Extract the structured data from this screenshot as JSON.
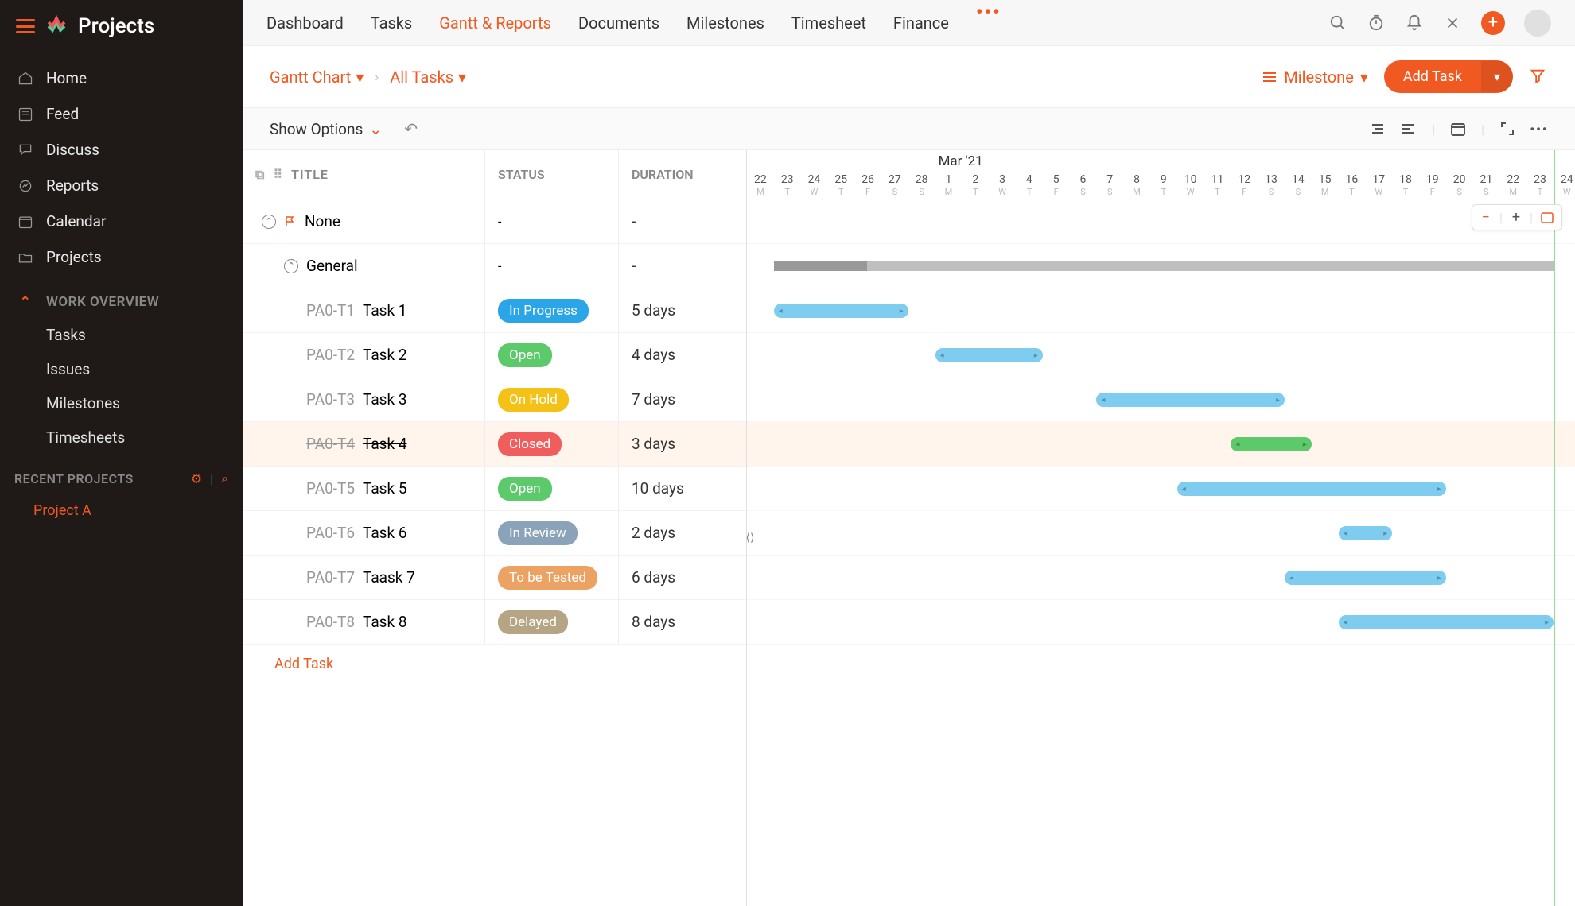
{
  "app": {
    "name": "Projects"
  },
  "sidebar": {
    "nav": [
      {
        "label": "Home",
        "icon": "home"
      },
      {
        "label": "Feed",
        "icon": "feed"
      },
      {
        "label": "Discuss",
        "icon": "discuss"
      },
      {
        "label": "Reports",
        "icon": "reports"
      },
      {
        "label": "Calendar",
        "icon": "calendar"
      },
      {
        "label": "Projects",
        "icon": "projects"
      }
    ],
    "work_overview": {
      "title": "WORK OVERVIEW",
      "items": [
        "Tasks",
        "Issues",
        "Milestones",
        "Timesheets"
      ]
    },
    "recent": {
      "title": "RECENT PROJECTS",
      "items": [
        "Project A"
      ]
    }
  },
  "tabs": [
    "Dashboard",
    "Tasks",
    "Gantt & Reports",
    "Documents",
    "Milestones",
    "Timesheet",
    "Finance"
  ],
  "active_tab": "Gantt & Reports",
  "breadcrumb": {
    "a": "Gantt Chart",
    "b": "All Tasks"
  },
  "milestone_label": "Milestone",
  "add_task_btn": "Add Task",
  "show_options": "Show Options",
  "columns": {
    "title": "TITLE",
    "status": "STATUS",
    "duration": "DURATION"
  },
  "groups": {
    "none": "None",
    "general": "General"
  },
  "tasks": [
    {
      "id": "PA0-T1",
      "name": "Task 1",
      "status": "In Progress",
      "status_color": "#2aa6e8",
      "duration": "5 days",
      "start": 1,
      "span": 5,
      "color": "#7ecdf0"
    },
    {
      "id": "PA0-T2",
      "name": "Task 2",
      "status": "Open",
      "status_color": "#5cc96b",
      "duration": "4 days",
      "start": 7,
      "span": 4,
      "color": "#7ecdf0"
    },
    {
      "id": "PA0-T3",
      "name": "Task 3",
      "status": "On Hold",
      "status_color": "#f4c217",
      "duration": "7 days",
      "start": 13,
      "span": 7,
      "color": "#7ecdf0"
    },
    {
      "id": "PA0-T4",
      "name": "Task 4",
      "status": "Closed",
      "status_color": "#ef5d5d",
      "duration": "3 days",
      "start": 18,
      "span": 3,
      "color": "#5cc96b",
      "strike": true,
      "highlight": true
    },
    {
      "id": "PA0-T5",
      "name": "Task 5",
      "status": "Open",
      "status_color": "#5cc96b",
      "duration": "10 days",
      "start": 16,
      "span": 10,
      "color": "#7ecdf0"
    },
    {
      "id": "PA0-T6",
      "name": "Task 6",
      "status": "In Review",
      "status_color": "#8aa3b8",
      "duration": "2 days",
      "start": 22,
      "span": 2,
      "color": "#7ecdf0"
    },
    {
      "id": "PA0-T7",
      "name": "Taask 7",
      "status": "To be Tested",
      "status_color": "#eba262",
      "duration": "6 days",
      "start": 20,
      "span": 6,
      "color": "#7ecdf0"
    },
    {
      "id": "PA0-T8",
      "name": "Task 8",
      "status": "Delayed",
      "status_color": "#b5a584",
      "duration": "8 days",
      "start": 22,
      "span": 8,
      "color": "#7ecdf0"
    }
  ],
  "add_task_link": "Add Task",
  "timeline": {
    "month": "Mar '21",
    "month_start_index": 7,
    "summary_start": 1,
    "summary_span": 29,
    "today_index": 30,
    "days": [
      {
        "d": "22",
        "w": "M"
      },
      {
        "d": "23",
        "w": "T"
      },
      {
        "d": "24",
        "w": "W"
      },
      {
        "d": "25",
        "w": "T"
      },
      {
        "d": "26",
        "w": "F"
      },
      {
        "d": "27",
        "w": "S"
      },
      {
        "d": "28",
        "w": "S"
      },
      {
        "d": "1",
        "w": "M"
      },
      {
        "d": "2",
        "w": "T"
      },
      {
        "d": "3",
        "w": "W"
      },
      {
        "d": "4",
        "w": "T"
      },
      {
        "d": "5",
        "w": "F"
      },
      {
        "d": "6",
        "w": "S"
      },
      {
        "d": "7",
        "w": "S"
      },
      {
        "d": "8",
        "w": "M"
      },
      {
        "d": "9",
        "w": "T"
      },
      {
        "d": "10",
        "w": "W"
      },
      {
        "d": "11",
        "w": "T"
      },
      {
        "d": "12",
        "w": "F"
      },
      {
        "d": "13",
        "w": "S"
      },
      {
        "d": "14",
        "w": "S"
      },
      {
        "d": "15",
        "w": "M"
      },
      {
        "d": "16",
        "w": "T"
      },
      {
        "d": "17",
        "w": "W"
      },
      {
        "d": "18",
        "w": "T"
      },
      {
        "d": "19",
        "w": "F"
      },
      {
        "d": "20",
        "w": "S"
      },
      {
        "d": "21",
        "w": "S"
      },
      {
        "d": "22",
        "w": "M"
      },
      {
        "d": "23",
        "w": "T"
      },
      {
        "d": "24",
        "w": "W"
      }
    ]
  },
  "chart_data": {
    "type": "gantt",
    "title": "Gantt Chart — All Tasks",
    "x_unit": "days",
    "x_start": "2021-02-22",
    "tasks": [
      {
        "id": "PA0-T1",
        "name": "Task 1",
        "start": "2021-02-23",
        "duration_days": 5,
        "status": "In Progress"
      },
      {
        "id": "PA0-T2",
        "name": "Task 2",
        "start": "2021-03-01",
        "duration_days": 4,
        "status": "Open"
      },
      {
        "id": "PA0-T3",
        "name": "Task 3",
        "start": "2021-03-07",
        "duration_days": 7,
        "status": "On Hold"
      },
      {
        "id": "PA0-T4",
        "name": "Task 4",
        "start": "2021-03-12",
        "duration_days": 3,
        "status": "Closed"
      },
      {
        "id": "PA0-T5",
        "name": "Task 5",
        "start": "2021-03-10",
        "duration_days": 10,
        "status": "Open"
      },
      {
        "id": "PA0-T6",
        "name": "Task 6",
        "start": "2021-03-16",
        "duration_days": 2,
        "status": "In Review"
      },
      {
        "id": "PA0-T7",
        "name": "Taask 7",
        "start": "2021-03-14",
        "duration_days": 6,
        "status": "To be Tested"
      },
      {
        "id": "PA0-T8",
        "name": "Task 8",
        "start": "2021-03-16",
        "duration_days": 8,
        "status": "Delayed"
      }
    ]
  }
}
